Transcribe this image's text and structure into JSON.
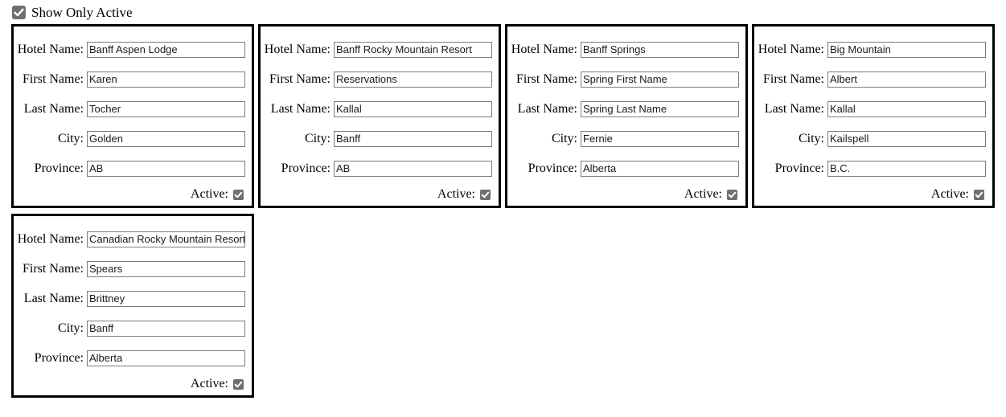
{
  "header": {
    "show_only_active_label": "Show Only Active",
    "show_only_active_checked": true,
    "checkbox_icon": "checkmark-icon"
  },
  "field_labels": {
    "hotel_name": "Hotel Name:",
    "first_name": "First Name:",
    "last_name": "Last Name:",
    "city": "City:",
    "province": "Province:",
    "active": "Active:"
  },
  "colors": {
    "card_border": "#000000",
    "input_border": "#7c7c7c",
    "checkbox_fill": "#6f6f6f",
    "checkbox_check": "#ffffff",
    "page_background": "#ffffff",
    "text": "#000000"
  },
  "cards": [
    {
      "hotel_name": "Banff Aspen Lodge",
      "first_name": "Karen",
      "last_name": "Tocher",
      "city": "Golden",
      "province": "AB",
      "active": true
    },
    {
      "hotel_name": "Banff Rocky Mountain Resort",
      "first_name": "Reservations",
      "last_name": "Kallal",
      "city": "Banff",
      "province": "AB",
      "active": true
    },
    {
      "hotel_name": "Banff Springs",
      "first_name": "Spring First Name",
      "last_name": "Spring Last Name",
      "city": "Fernie",
      "province": "Alberta",
      "active": true
    },
    {
      "hotel_name": "Big Mountain",
      "first_name": "Albert",
      "last_name": "Kallal",
      "city": "Kailspell",
      "province": "B.C.",
      "active": true
    },
    {
      "hotel_name": "Canadian Rocky Mountain Resort",
      "first_name": "Spears",
      "last_name": "Brittney",
      "city": "Banff",
      "province": "Alberta",
      "active": true
    }
  ]
}
